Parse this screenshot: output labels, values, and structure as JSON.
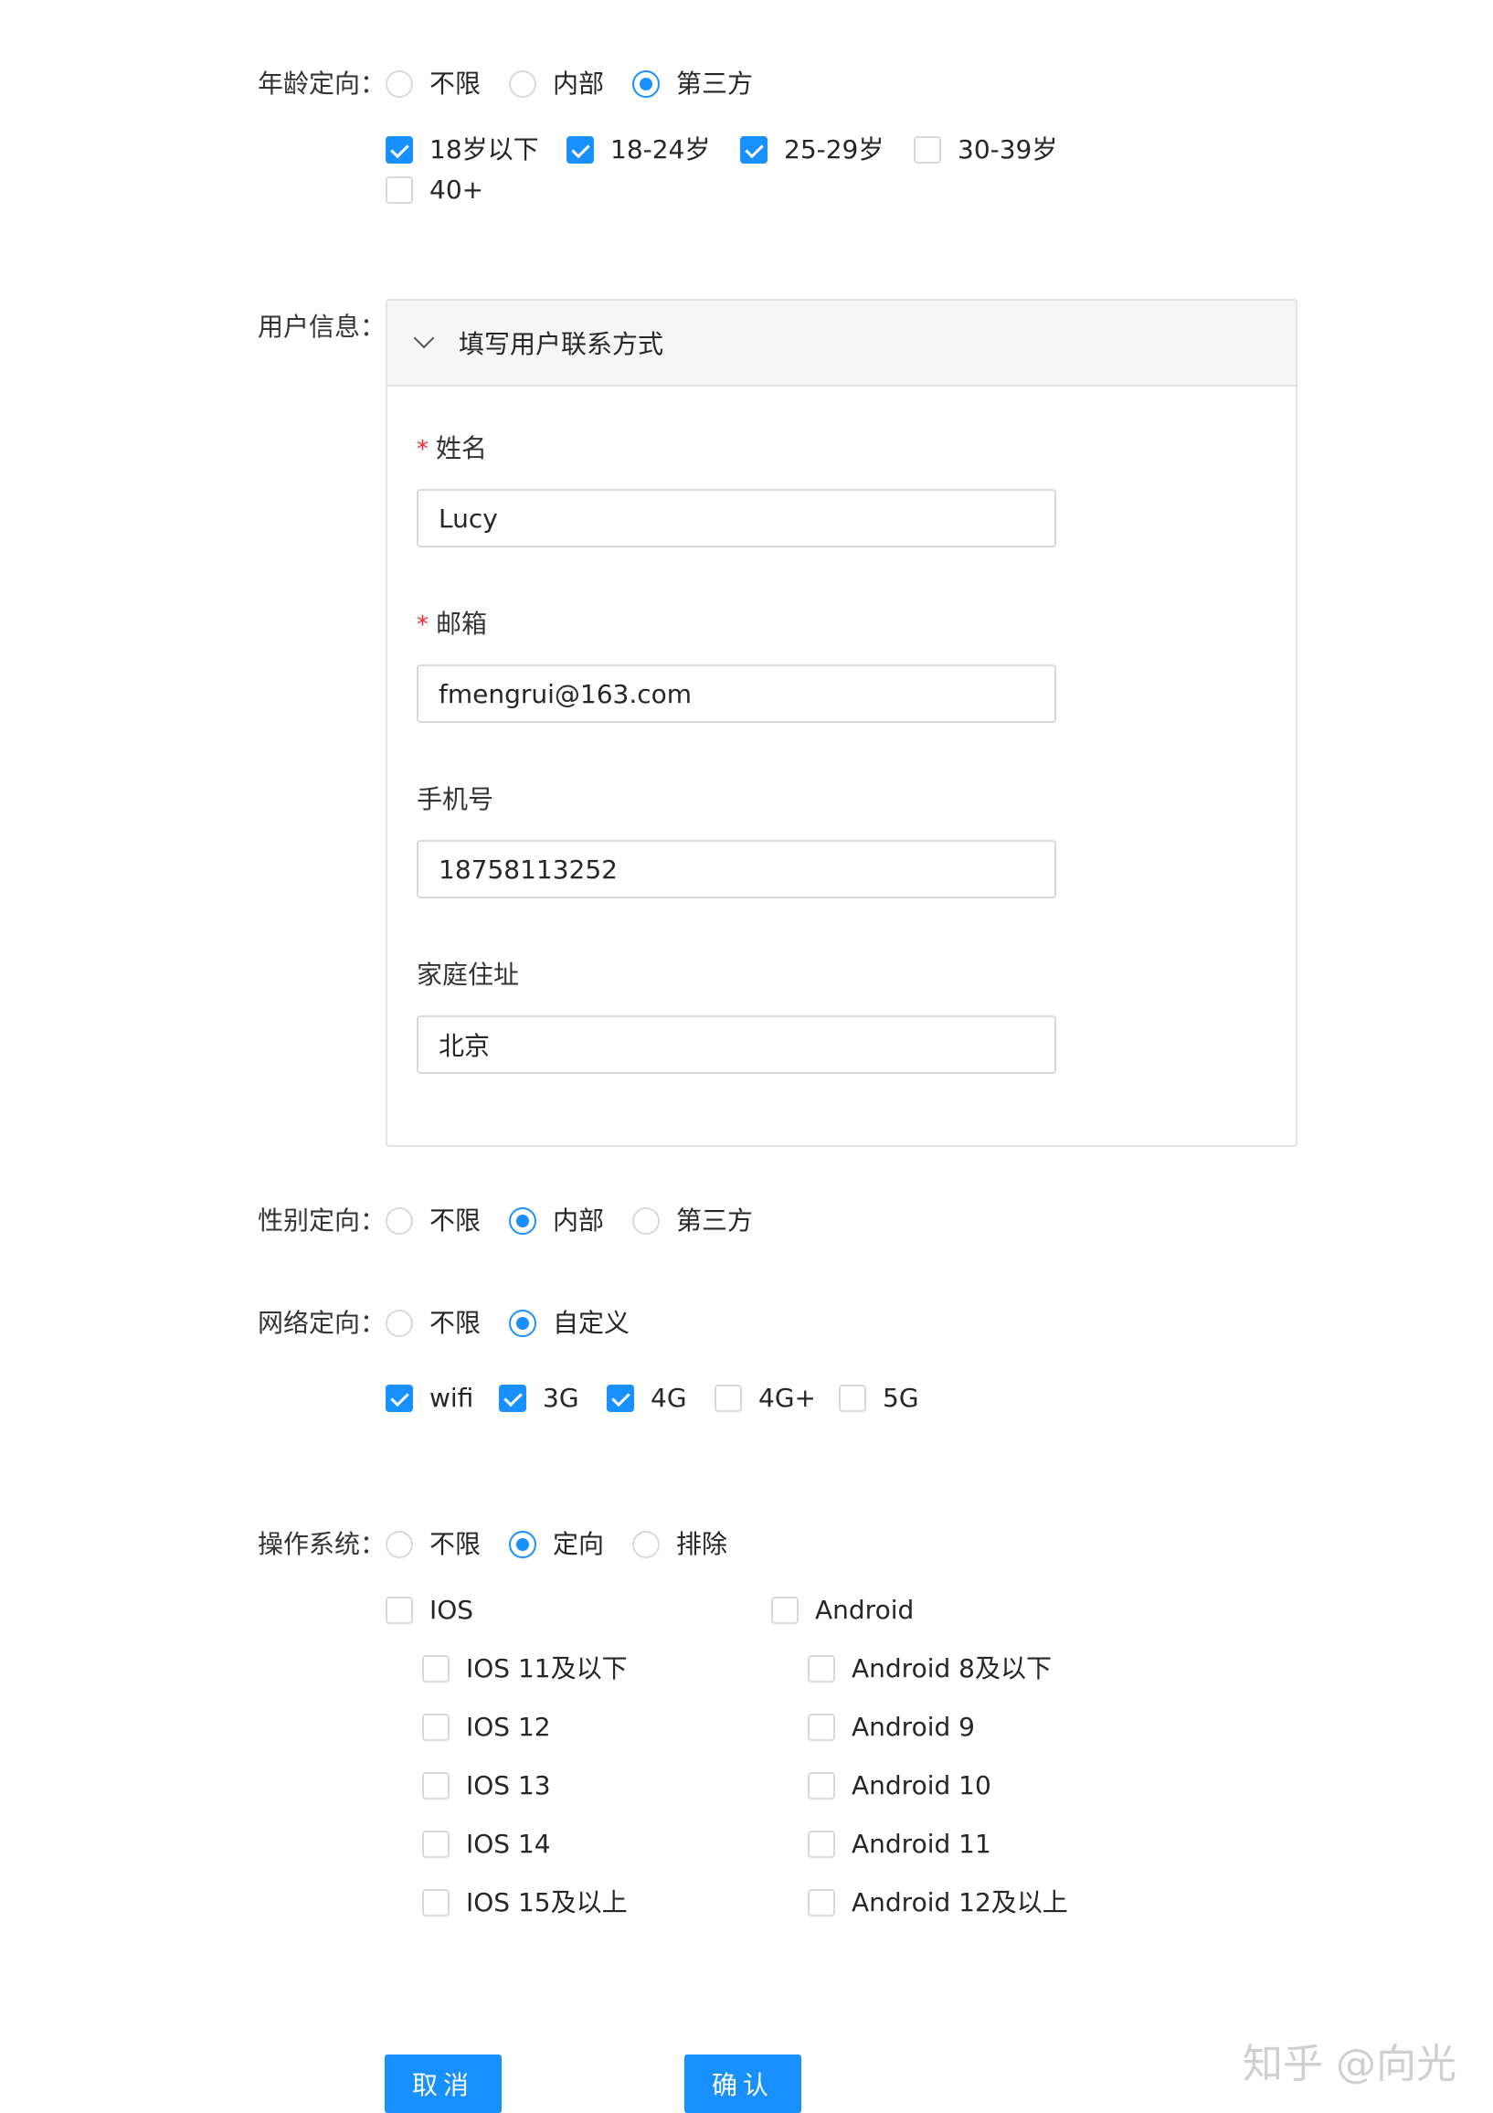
{
  "age": {
    "label": "年龄定向：",
    "radios": [
      {
        "label": "不限",
        "checked": false
      },
      {
        "label": "内部",
        "checked": false
      },
      {
        "label": "第三方",
        "checked": true
      }
    ],
    "checks": [
      {
        "label": "18岁以下",
        "checked": true
      },
      {
        "label": "18-24岁",
        "checked": true
      },
      {
        "label": "25-29岁",
        "checked": true
      },
      {
        "label": "30-39岁",
        "checked": false
      },
      {
        "label": "40+",
        "checked": false
      }
    ]
  },
  "user_info": {
    "label": "用户信息：",
    "panel_title": "填写用户联系方式",
    "fields": [
      {
        "label": "姓名",
        "required": true,
        "value": "Lucy"
      },
      {
        "label": "邮箱",
        "required": true,
        "value": "fmengrui@163.com"
      },
      {
        "label": "手机号",
        "required": false,
        "value": "18758113252"
      },
      {
        "label": "家庭住址",
        "required": false,
        "value": "北京"
      }
    ]
  },
  "gender": {
    "label": "性别定向：",
    "radios": [
      {
        "label": "不限",
        "checked": false
      },
      {
        "label": "内部",
        "checked": true
      },
      {
        "label": "第三方",
        "checked": false
      }
    ]
  },
  "network": {
    "label": "网络定向：",
    "radios": [
      {
        "label": "不限",
        "checked": false
      },
      {
        "label": "自定义",
        "checked": true
      }
    ],
    "checks": [
      {
        "label": "wifi",
        "checked": true
      },
      {
        "label": "3G",
        "checked": true
      },
      {
        "label": "4G",
        "checked": true
      },
      {
        "label": "4G+",
        "checked": false
      },
      {
        "label": "5G",
        "checked": false
      }
    ]
  },
  "os": {
    "label": "操作系统：",
    "radios": [
      {
        "label": "不限",
        "checked": false
      },
      {
        "label": "定向",
        "checked": true
      },
      {
        "label": "排除",
        "checked": false
      }
    ],
    "ios": {
      "label": "IOS",
      "checked": false,
      "items": [
        {
          "label": "IOS 11及以下",
          "checked": false
        },
        {
          "label": "IOS 12",
          "checked": false
        },
        {
          "label": "IOS 13",
          "checked": false
        },
        {
          "label": "IOS 14",
          "checked": false
        },
        {
          "label": "IOS 15及以上",
          "checked": false
        }
      ]
    },
    "android": {
      "label": "Android",
      "checked": false,
      "items": [
        {
          "label": "Android 8及以下",
          "checked": false
        },
        {
          "label": "Android 9",
          "checked": false
        },
        {
          "label": "Android 10",
          "checked": false
        },
        {
          "label": "Android 11",
          "checked": false
        },
        {
          "label": "Android 12及以上",
          "checked": false
        }
      ]
    }
  },
  "buttons": {
    "cancel": "取消",
    "confirm": "确认"
  },
  "watermark": "知乎 @向光",
  "colors": {
    "accent": "#1890ff",
    "required": "#f5222d",
    "border": "#d9d9d9"
  }
}
